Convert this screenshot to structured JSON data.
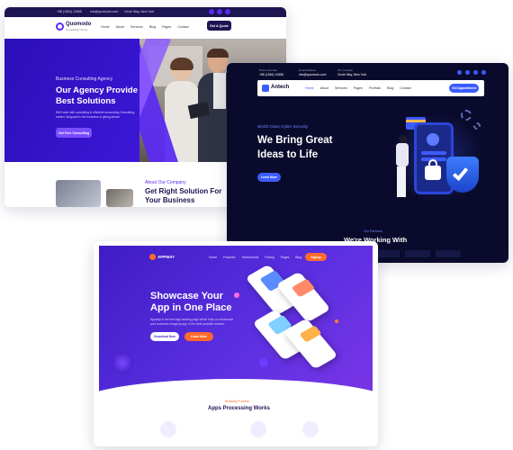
{
  "quomodo": {
    "topbar": {
      "phone": "+88 (1564) 12658",
      "email": "info@quomodo.com",
      "address": "Circle Way, New York"
    },
    "brand": {
      "name": "Quomodo",
      "tagline": "Consulting Theme"
    },
    "nav": [
      "Home",
      "About",
      "Services",
      "Blog",
      "Pages",
      "Contact"
    ],
    "cta": "Get A Quote",
    "hero": {
      "eyebrow": "Business Consulting Agency",
      "title_line1": "Our Agency Provide",
      "title_line2": "Best Solutions",
      "text_line1": "We'll start with consulting in effective accounting Consulting,",
      "text_line2": "means Tanguard in the business of giving advice",
      "button": "Get Free Consulting"
    },
    "about": {
      "eyebrow": "About Our Company",
      "title_line1": "Get Right Solution For",
      "title_line2": "Your Business"
    }
  },
  "antech": {
    "topbar": {
      "phone_label": "Phone Number",
      "phone": "+88 (1564) 12658",
      "email_label": "Email Address",
      "email": "info@quomodo.com",
      "address_label": "Our Location",
      "address": "Circle Way, New York"
    },
    "brand": {
      "name": "Antech"
    },
    "nav": [
      "Home",
      "About",
      "Services",
      "Pages",
      "Portfolio",
      "Blog",
      "Contact"
    ],
    "cta": "Get Appointment",
    "hero": {
      "eyebrow": "World Class Cyber Security",
      "title_line1": "We Bring Great",
      "title_line2": "Ideas to Life",
      "button": "Learn More"
    },
    "partners": {
      "eyebrow": "Our Partners",
      "title": "We're Working With"
    }
  },
  "appway": {
    "brand": {
      "name": "APPWAY"
    },
    "nav": [
      "Home",
      "Features",
      "Screenshots",
      "Pricing",
      "Pages",
      "Blog",
      "Contact"
    ],
    "cta": "Signup",
    "hero": {
      "title_line1": "Showcase Your",
      "title_line2": "App in One Place",
      "text_line1": "Appway is the best app landing page which help you showcase",
      "text_line2": "your business shopping app in the best possible manner.",
      "button1": "Download Now",
      "button2": "Learn More"
    },
    "process": {
      "eyebrow": "Working Process",
      "title": "Apps Processing Works"
    }
  },
  "colors": {
    "quomodo_accent": "#5b2bf0",
    "quomodo_dark": "#1d1452",
    "antech_bg": "#0a0b2c",
    "antech_accent": "#3d5cff",
    "appway_purple": "#4b27d6",
    "appway_orange": "#ff6a2b"
  }
}
